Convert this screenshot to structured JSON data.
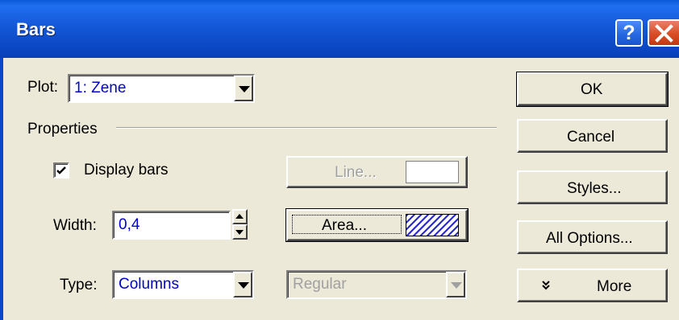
{
  "window": {
    "title": "Bars",
    "help_glyph": "?"
  },
  "plot": {
    "label": "Plot:",
    "value": "1: Zene"
  },
  "properties": {
    "label": "Properties"
  },
  "display_bars": {
    "label": "Display bars",
    "checked": true
  },
  "width": {
    "label": "Width:",
    "value": "0,4"
  },
  "line_button": {
    "label": "Line...",
    "enabled": false
  },
  "area_button": {
    "label": "Area...",
    "swatch_color": "#2a2acf",
    "swatch_pattern": "diagonal-hatch"
  },
  "type": {
    "label": "Type:",
    "value": "Columns"
  },
  "style_combo": {
    "value": "Regular",
    "enabled": false
  },
  "buttons": {
    "ok": "OK",
    "cancel": "Cancel",
    "styles": "Styles...",
    "all_options": "All Options...",
    "more": "More",
    "more_icon": "double-chevron-down-icon"
  },
  "colors": {
    "titlebar": "#0b48c4",
    "dialog_bg": "#ece9d8",
    "value_text": "#0000d0",
    "close_button": "#d84d24"
  }
}
